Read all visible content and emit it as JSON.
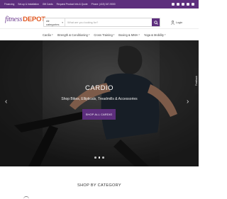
{
  "top_bar": {
    "links": [
      "Financing",
      "Set-up & Installation",
      "Gift Cards",
      "Request Product Info & Quote",
      "Phone: (415) 347-9000"
    ],
    "social_icons": [
      "facebook-icon",
      "instagram-icon",
      "youtube-icon",
      "twitter-icon",
      "linkedin-icon"
    ]
  },
  "header": {
    "logo_fitness": "fitness",
    "logo_depot": "DEPOT",
    "category_select": "All categories",
    "search_placeholder": "What are you looking for?",
    "login_label": "Login"
  },
  "nav": {
    "items": [
      "Cardio",
      "Strength & Conditioning",
      "Cross Training",
      "Boxing & MMA",
      "Yoga & Mobility"
    ]
  },
  "hero": {
    "title": "CARDIO",
    "subtitle": "Shop Bikes, Ellipticals, Treadmills & Accessories",
    "cta_label": "SHOP ALL CARDIO",
    "prev_label": "‹",
    "next_label": "›",
    "slide_count": 3,
    "active_slide": 1
  },
  "feedback_tab": "Feedback",
  "shop": {
    "heading": "SHOP BY CATEGORY"
  },
  "colors": {
    "brand_purple": "#5d2e7d",
    "logo_purple": "#6c3b8d",
    "logo_orange": "#e0561f"
  }
}
